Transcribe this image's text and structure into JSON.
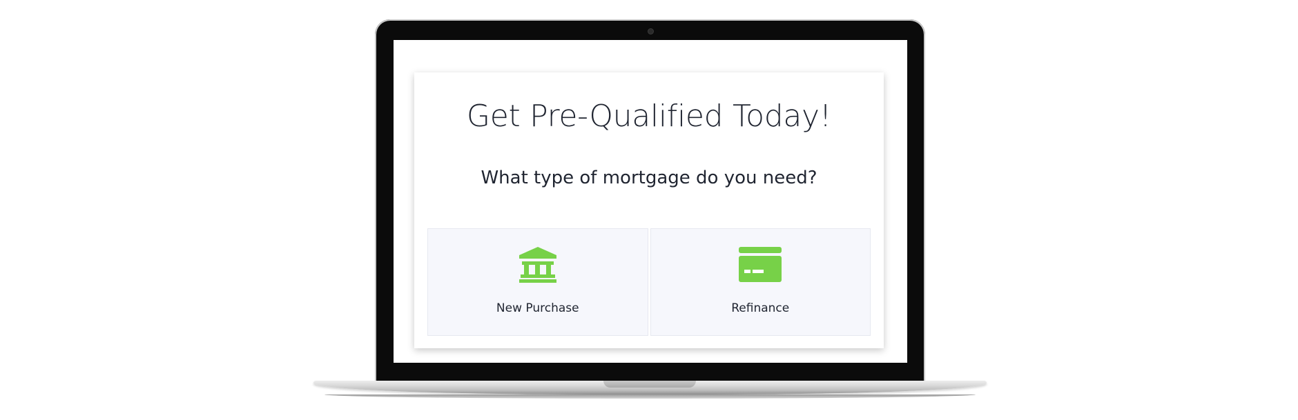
{
  "card": {
    "title": "Get Pre-Qualified Today!",
    "subtitle": "What type of mortgage do you need?"
  },
  "options": [
    {
      "label": "New Purchase",
      "icon": "bank-icon"
    },
    {
      "label": "Refinance",
      "icon": "credit-card-icon"
    }
  ],
  "colors": {
    "accent": "#77d148",
    "text": "#1f2430",
    "option_bg": "#f6f7fc"
  }
}
